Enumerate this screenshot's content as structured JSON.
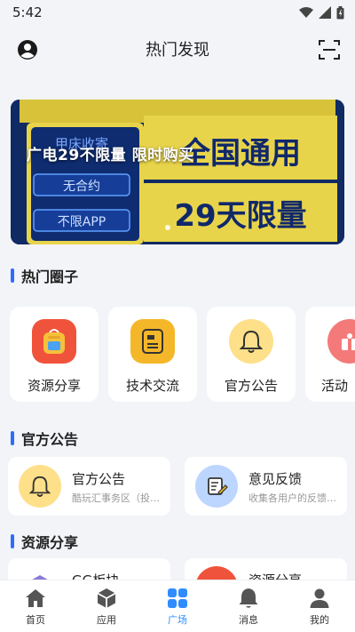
{
  "status": {
    "time": "5:42"
  },
  "header": {
    "title": "热门发现"
  },
  "banner": {
    "headline": "广电29不限量 限时购买",
    "art": {
      "left_lines": [
        "无合约",
        "不限APP"
      ],
      "top_partial": "甲床收寄",
      "right_lines": [
        "全国通用",
        "29天限量"
      ]
    }
  },
  "hot_circles": {
    "title": "热门圈子",
    "items": [
      {
        "label": "资源分享",
        "icon": "backpack-icon",
        "color": "#f0533b"
      },
      {
        "label": "技术交流",
        "icon": "note-icon",
        "color": "#f5b72a"
      },
      {
        "label": "官方公告",
        "icon": "bell-icon",
        "color": "#fde089"
      },
      {
        "label": "活动",
        "icon": "gift-icon",
        "color": "#f47a7a"
      }
    ]
  },
  "announcements": {
    "title": "官方公告",
    "items": [
      {
        "title": "官方公告",
        "subtitle": "酷玩汇事务区（投诉举报）",
        "icon": "bell-icon",
        "color": "#fde089"
      },
      {
        "title": "意见反馈",
        "subtitle": "收集各用户的反馈意见",
        "icon": "feedback-icon",
        "color": "#bcd6ff"
      }
    ]
  },
  "resources": {
    "title": "资源分享",
    "items": [
      {
        "title": "GG板块",
        "icon": "cube-icon"
      },
      {
        "title": "资源分享",
        "icon": "backpack-icon"
      }
    ]
  },
  "tabbar": {
    "items": [
      {
        "label": "首页",
        "icon": "home-icon"
      },
      {
        "label": "应用",
        "icon": "box-icon"
      },
      {
        "label": "广场",
        "icon": "grid-icon",
        "active": true
      },
      {
        "label": "消息",
        "icon": "bell-icon"
      },
      {
        "label": "我的",
        "icon": "person-icon"
      }
    ],
    "active_color": "#2f8cff"
  }
}
